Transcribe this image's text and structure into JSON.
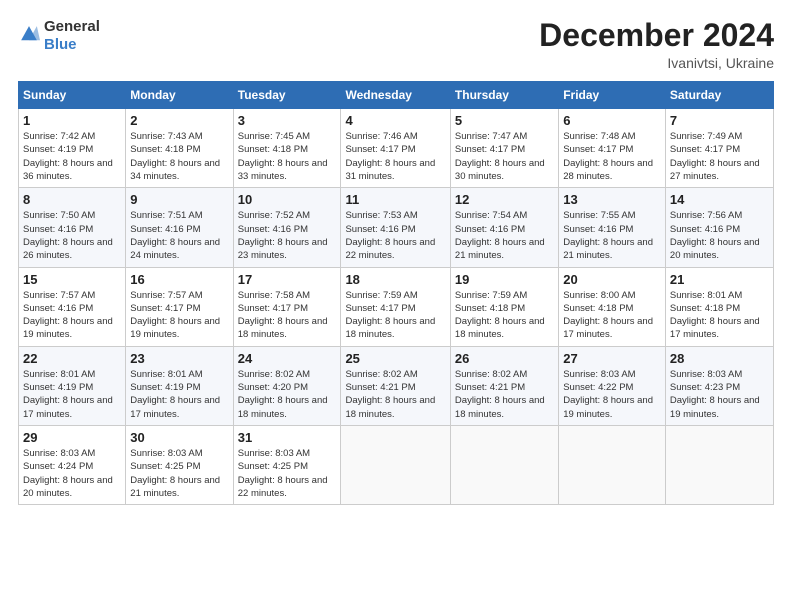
{
  "header": {
    "logo_general": "General",
    "logo_blue": "Blue",
    "title": "December 2024",
    "location": "Ivanivtsi, Ukraine"
  },
  "columns": [
    "Sunday",
    "Monday",
    "Tuesday",
    "Wednesday",
    "Thursday",
    "Friday",
    "Saturday"
  ],
  "weeks": [
    [
      {
        "day": "1",
        "sunrise": "7:42 AM",
        "sunset": "4:19 PM",
        "daylight": "8 hours and 36 minutes."
      },
      {
        "day": "2",
        "sunrise": "7:43 AM",
        "sunset": "4:18 PM",
        "daylight": "8 hours and 34 minutes."
      },
      {
        "day": "3",
        "sunrise": "7:45 AM",
        "sunset": "4:18 PM",
        "daylight": "8 hours and 33 minutes."
      },
      {
        "day": "4",
        "sunrise": "7:46 AM",
        "sunset": "4:17 PM",
        "daylight": "8 hours and 31 minutes."
      },
      {
        "day": "5",
        "sunrise": "7:47 AM",
        "sunset": "4:17 PM",
        "daylight": "8 hours and 30 minutes."
      },
      {
        "day": "6",
        "sunrise": "7:48 AM",
        "sunset": "4:17 PM",
        "daylight": "8 hours and 28 minutes."
      },
      {
        "day": "7",
        "sunrise": "7:49 AM",
        "sunset": "4:17 PM",
        "daylight": "8 hours and 27 minutes."
      }
    ],
    [
      {
        "day": "8",
        "sunrise": "7:50 AM",
        "sunset": "4:16 PM",
        "daylight": "8 hours and 26 minutes."
      },
      {
        "day": "9",
        "sunrise": "7:51 AM",
        "sunset": "4:16 PM",
        "daylight": "8 hours and 24 minutes."
      },
      {
        "day": "10",
        "sunrise": "7:52 AM",
        "sunset": "4:16 PM",
        "daylight": "8 hours and 23 minutes."
      },
      {
        "day": "11",
        "sunrise": "7:53 AM",
        "sunset": "4:16 PM",
        "daylight": "8 hours and 22 minutes."
      },
      {
        "day": "12",
        "sunrise": "7:54 AM",
        "sunset": "4:16 PM",
        "daylight": "8 hours and 21 minutes."
      },
      {
        "day": "13",
        "sunrise": "7:55 AM",
        "sunset": "4:16 PM",
        "daylight": "8 hours and 21 minutes."
      },
      {
        "day": "14",
        "sunrise": "7:56 AM",
        "sunset": "4:16 PM",
        "daylight": "8 hours and 20 minutes."
      }
    ],
    [
      {
        "day": "15",
        "sunrise": "7:57 AM",
        "sunset": "4:16 PM",
        "daylight": "8 hours and 19 minutes."
      },
      {
        "day": "16",
        "sunrise": "7:57 AM",
        "sunset": "4:17 PM",
        "daylight": "8 hours and 19 minutes."
      },
      {
        "day": "17",
        "sunrise": "7:58 AM",
        "sunset": "4:17 PM",
        "daylight": "8 hours and 18 minutes."
      },
      {
        "day": "18",
        "sunrise": "7:59 AM",
        "sunset": "4:17 PM",
        "daylight": "8 hours and 18 minutes."
      },
      {
        "day": "19",
        "sunrise": "7:59 AM",
        "sunset": "4:18 PM",
        "daylight": "8 hours and 18 minutes."
      },
      {
        "day": "20",
        "sunrise": "8:00 AM",
        "sunset": "4:18 PM",
        "daylight": "8 hours and 17 minutes."
      },
      {
        "day": "21",
        "sunrise": "8:01 AM",
        "sunset": "4:18 PM",
        "daylight": "8 hours and 17 minutes."
      }
    ],
    [
      {
        "day": "22",
        "sunrise": "8:01 AM",
        "sunset": "4:19 PM",
        "daylight": "8 hours and 17 minutes."
      },
      {
        "day": "23",
        "sunrise": "8:01 AM",
        "sunset": "4:19 PM",
        "daylight": "8 hours and 17 minutes."
      },
      {
        "day": "24",
        "sunrise": "8:02 AM",
        "sunset": "4:20 PM",
        "daylight": "8 hours and 18 minutes."
      },
      {
        "day": "25",
        "sunrise": "8:02 AM",
        "sunset": "4:21 PM",
        "daylight": "8 hours and 18 minutes."
      },
      {
        "day": "26",
        "sunrise": "8:02 AM",
        "sunset": "4:21 PM",
        "daylight": "8 hours and 18 minutes."
      },
      {
        "day": "27",
        "sunrise": "8:03 AM",
        "sunset": "4:22 PM",
        "daylight": "8 hours and 19 minutes."
      },
      {
        "day": "28",
        "sunrise": "8:03 AM",
        "sunset": "4:23 PM",
        "daylight": "8 hours and 19 minutes."
      }
    ],
    [
      {
        "day": "29",
        "sunrise": "8:03 AM",
        "sunset": "4:24 PM",
        "daylight": "8 hours and 20 minutes."
      },
      {
        "day": "30",
        "sunrise": "8:03 AM",
        "sunset": "4:25 PM",
        "daylight": "8 hours and 21 minutes."
      },
      {
        "day": "31",
        "sunrise": "8:03 AM",
        "sunset": "4:25 PM",
        "daylight": "8 hours and 22 minutes."
      },
      null,
      null,
      null,
      null
    ]
  ]
}
